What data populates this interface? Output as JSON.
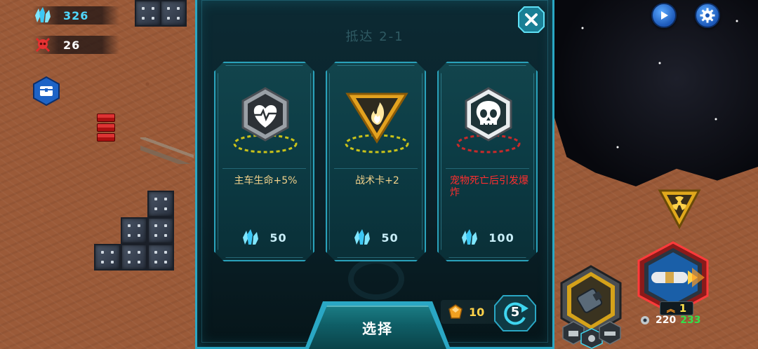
{
  "hud": {
    "crystals": "326",
    "kills": "26"
  },
  "modal": {
    "title": "抵达 2-1",
    "cards": [
      {
        "icon": "heart-pulse-icon",
        "description": "主车生命+5%",
        "cost": "50",
        "warn": false
      },
      {
        "icon": "fire-triangle-icon",
        "description": "战术卡+2",
        "cost": "50",
        "warn": false
      },
      {
        "icon": "skull-hex-icon",
        "description": "宠物死亡后引发爆炸",
        "cost": "100",
        "warn": true
      }
    ],
    "select_label": "选择",
    "refresh_count": "5",
    "gem_count": "10"
  },
  "weapon": {
    "level": "1",
    "ammo": "220",
    "reserve": "233"
  },
  "colors": {
    "frame": "#2aa7c4",
    "card_bg": "#0c3c45",
    "crystal": "#4fd8ff",
    "warn_text": "#ff2e2e",
    "desc_text": "#f2d28a",
    "gem_text": "#ffd24a",
    "ammo_green": "#34e04a"
  }
}
